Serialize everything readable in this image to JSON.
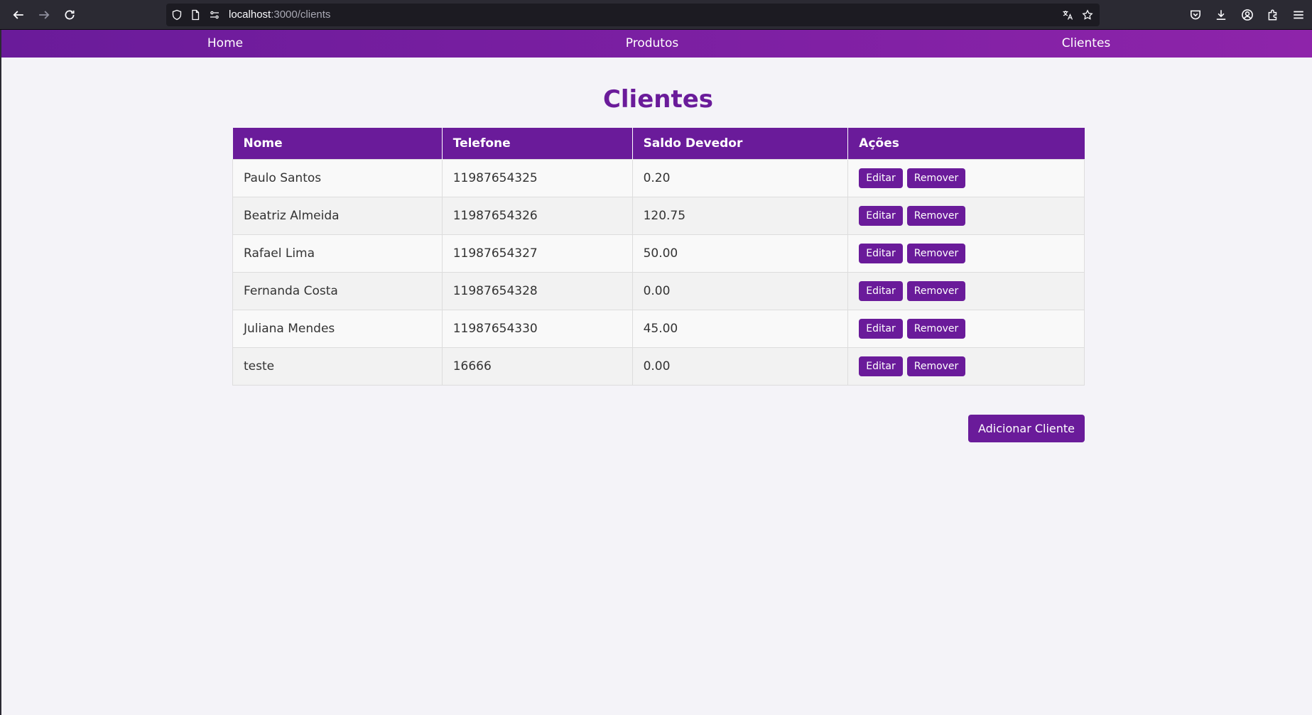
{
  "browser": {
    "url_host": "localhost",
    "url_path": ":3000/clients"
  },
  "nav": {
    "links": [
      {
        "label": "Home"
      },
      {
        "label": "Produtos"
      },
      {
        "label": "Clientes"
      }
    ]
  },
  "page": {
    "title": "Clientes",
    "add_button_label": "Adicionar Cliente"
  },
  "table": {
    "headers": [
      "Nome",
      "Telefone",
      "Saldo Devedor",
      "Ações"
    ],
    "edit_label": "Editar",
    "remove_label": "Remover",
    "rows": [
      {
        "nome": "Paulo Santos",
        "telefone": "11987654325",
        "saldo": "0.20"
      },
      {
        "nome": "Beatriz Almeida",
        "telefone": "11987654326",
        "saldo": "120.75"
      },
      {
        "nome": "Rafael Lima",
        "telefone": "11987654327",
        "saldo": "50.00"
      },
      {
        "nome": "Fernanda Costa",
        "telefone": "11987654328",
        "saldo": "0.00"
      },
      {
        "nome": "Juliana Mendes",
        "telefone": "11987654330",
        "saldo": "45.00"
      },
      {
        "nome": "teste",
        "telefone": "16666",
        "saldo": "0.00"
      }
    ]
  },
  "colors": {
    "accent": "#6a1b9a",
    "nav_gradient_end": "#8e24aa",
    "page_background": "#f4f3f8"
  }
}
